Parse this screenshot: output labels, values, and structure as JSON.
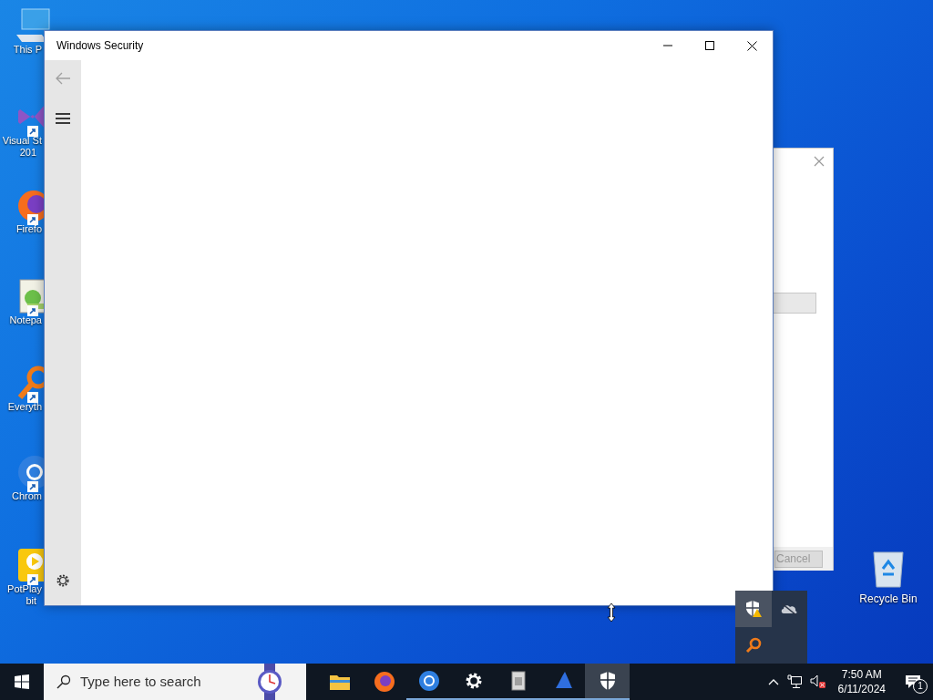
{
  "desktop_icons": [
    {
      "kind": "pc",
      "lines": [
        "This P"
      ]
    },
    {
      "kind": "studio",
      "lines": [
        "Visual St",
        "201"
      ]
    },
    {
      "kind": "firefox",
      "lines": [
        "Firefo"
      ]
    },
    {
      "kind": "notepad",
      "lines": [
        "Notepa"
      ]
    },
    {
      "kind": "everything",
      "lines": [
        "Everyth"
      ]
    },
    {
      "kind": "chrome",
      "lines": [
        "Chrom"
      ]
    },
    {
      "kind": "potplayer",
      "lines": [
        "PotPlay",
        "bit"
      ]
    }
  ],
  "recycle_bin": {
    "label": "Recycle Bin"
  },
  "window": {
    "title": "Windows Security"
  },
  "background_dialog": {
    "button": "Cancel"
  },
  "tray_flyout": [
    {
      "kind": "shield",
      "selected": true
    },
    {
      "kind": "cloud",
      "selected": false
    },
    {
      "kind": "search",
      "selected": false
    }
  ],
  "taskbar": {
    "search_placeholder": "Type here to search",
    "apps": [
      {
        "kind": "explorer",
        "running": false,
        "selected": false
      },
      {
        "kind": "firefox",
        "running": false,
        "selected": false
      },
      {
        "kind": "chrome",
        "running": true,
        "selected": false
      },
      {
        "kind": "gear",
        "running": true,
        "selected": false
      },
      {
        "kind": "archive",
        "running": true,
        "selected": false
      },
      {
        "kind": "sail",
        "running": true,
        "selected": false
      },
      {
        "kind": "shield",
        "running": true,
        "selected": true
      }
    ],
    "time": "7:50 AM",
    "date": "6/11/2024",
    "notification_count": "1"
  }
}
